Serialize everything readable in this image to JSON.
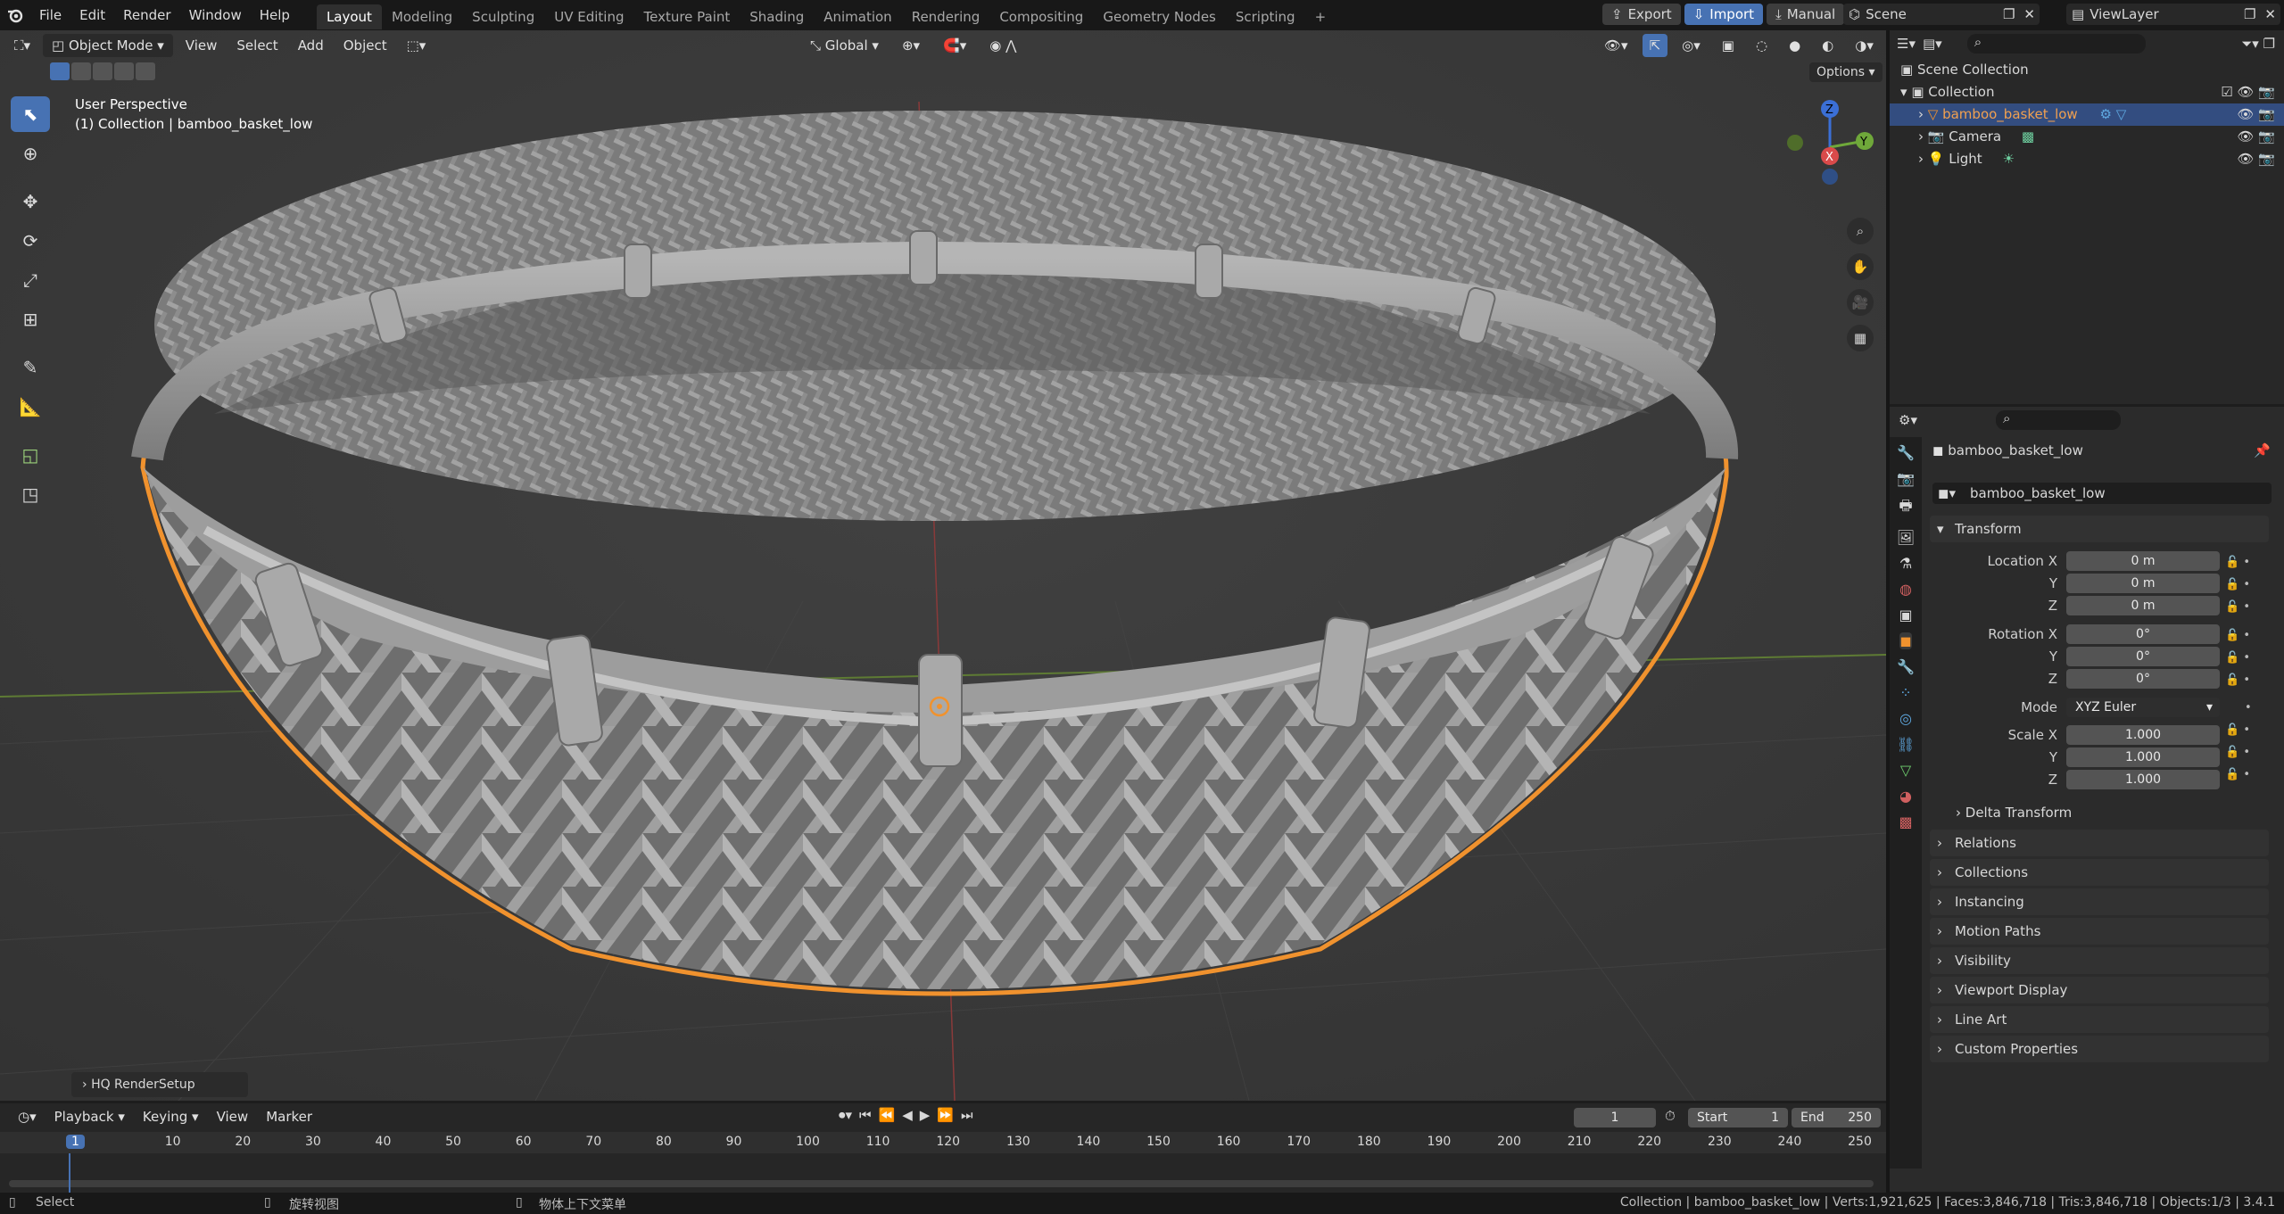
{
  "menu": [
    "File",
    "Edit",
    "Render",
    "Window",
    "Help"
  ],
  "workspaces": [
    "Layout",
    "Modeling",
    "Sculpting",
    "UV Editing",
    "Texture Paint",
    "Shading",
    "Animation",
    "Rendering",
    "Compositing",
    "Geometry Nodes",
    "Scripting",
    "+"
  ],
  "top_right": {
    "export": "Export",
    "import": "Import",
    "manual": "Manual",
    "scene": "Scene",
    "viewlayer": "ViewLayer"
  },
  "viewport": {
    "mode": "Object Mode",
    "menus": [
      "View",
      "Select",
      "Add",
      "Object"
    ],
    "orientation": "Global",
    "options": "Options",
    "overlay_line1": "User Perspective",
    "overlay_line2": "(1) Collection | bamboo_basket_low",
    "operator_panel": "HQ RenderSetup",
    "gizmo": {
      "z": "Z",
      "y": "Y",
      "x": "X"
    }
  },
  "outliner": {
    "scene_collection": "Scene Collection",
    "collection": "Collection",
    "items": [
      "bamboo_basket_low",
      "Camera",
      "Light"
    ]
  },
  "properties": {
    "object_name": "bamboo_basket_low",
    "object_field": "bamboo_basket_low",
    "transform": "Transform",
    "location": {
      "label_x": "Location X",
      "label_y": "Y",
      "label_z": "Z",
      "x": "0 m",
      "y": "0 m",
      "z": "0 m"
    },
    "rotation": {
      "label_x": "Rotation X",
      "label_y": "Y",
      "label_z": "Z",
      "x": "0°",
      "y": "0°",
      "z": "0°"
    },
    "mode_label": "Mode",
    "mode_value": "XYZ Euler",
    "scale": {
      "label_x": "Scale X",
      "label_y": "Y",
      "label_z": "Z",
      "x": "1.000",
      "y": "1.000",
      "z": "1.000"
    },
    "delta": "Delta Transform",
    "panels": [
      "Relations",
      "Collections",
      "Instancing",
      "Motion Paths",
      "Visibility",
      "Viewport Display",
      "Line Art",
      "Custom Properties"
    ]
  },
  "timeline": {
    "menus": [
      "Playback",
      "Keying",
      "View",
      "Marker"
    ],
    "current_frame": "1",
    "start_label": "Start",
    "start": "1",
    "end_label": "End",
    "end": "250",
    "ruler": [
      "1",
      "10",
      "20",
      "30",
      "40",
      "50",
      "60",
      "70",
      "80",
      "90",
      "100",
      "110",
      "120",
      "130",
      "140",
      "150",
      "160",
      "170",
      "180",
      "190",
      "200",
      "210",
      "220",
      "230",
      "240",
      "250"
    ]
  },
  "status": {
    "select": "Select",
    "rotate": "旋转视图",
    "context": "物体上下文菜单",
    "stats": "Collection | bamboo_basket_low | Verts:1,921,625 | Faces:3,846,718 | Tris:3,846,718 | Objects:1/3 | 3.4.1"
  },
  "colors": {
    "accent": "#4772b3",
    "selection": "#f0922e",
    "bg": "#393939"
  }
}
